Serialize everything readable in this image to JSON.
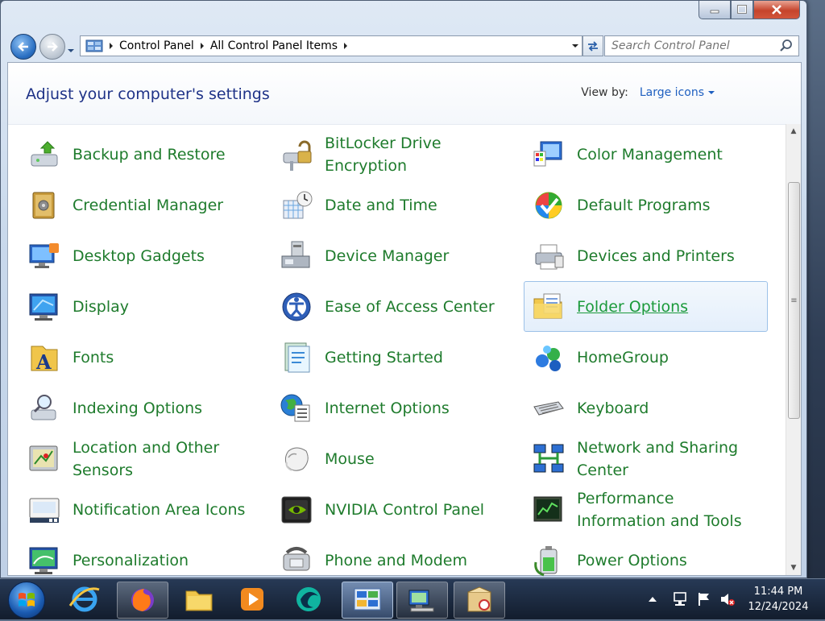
{
  "window": {
    "caption_buttons": [
      "minimize-icon",
      "maximize-icon",
      "close-icon"
    ]
  },
  "address_bar": {
    "crumbs": [
      "Control Panel",
      "All Control Panel Items"
    ]
  },
  "search": {
    "placeholder": "Search Control Panel"
  },
  "header": {
    "title": "Adjust your computer's settings",
    "view_by_label": "View by:",
    "view_by_value": "Large icons"
  },
  "items": [
    {
      "label": "Backup and Restore",
      "icon": "backup-icon"
    },
    {
      "label": "BitLocker Drive Encryption",
      "icon": "bitlocker-icon"
    },
    {
      "label": "Color Management",
      "icon": "color-management-icon"
    },
    {
      "label": "Credential Manager",
      "icon": "credential-manager-icon"
    },
    {
      "label": "Date and Time",
      "icon": "date-time-icon"
    },
    {
      "label": "Default Programs",
      "icon": "default-programs-icon"
    },
    {
      "label": "Desktop Gadgets",
      "icon": "desktop-gadgets-icon"
    },
    {
      "label": "Device Manager",
      "icon": "device-manager-icon"
    },
    {
      "label": "Devices and Printers",
      "icon": "printer-icon"
    },
    {
      "label": "Display",
      "icon": "display-icon"
    },
    {
      "label": "Ease of Access Center",
      "icon": "ease-of-access-icon"
    },
    {
      "label": "Folder Options",
      "icon": "folder-options-icon",
      "selected": true
    },
    {
      "label": "Fonts",
      "icon": "fonts-icon"
    },
    {
      "label": "Getting Started",
      "icon": "getting-started-icon"
    },
    {
      "label": "HomeGroup",
      "icon": "homegroup-icon"
    },
    {
      "label": "Indexing Options",
      "icon": "indexing-icon"
    },
    {
      "label": "Internet Options",
      "icon": "internet-options-icon"
    },
    {
      "label": "Keyboard",
      "icon": "keyboard-icon"
    },
    {
      "label": "Location and Other Sensors",
      "icon": "location-sensors-icon"
    },
    {
      "label": "Mouse",
      "icon": "mouse-icon"
    },
    {
      "label": "Network and Sharing Center",
      "icon": "network-icon"
    },
    {
      "label": "Notification Area Icons",
      "icon": "notification-area-icon"
    },
    {
      "label": "NVIDIA Control Panel",
      "icon": "nvidia-icon"
    },
    {
      "label": "Performance Information and Tools",
      "icon": "performance-icon"
    },
    {
      "label": "Personalization",
      "icon": "personalization-icon"
    },
    {
      "label": "Phone and Modem",
      "icon": "phone-modem-icon"
    },
    {
      "label": "Power Options",
      "icon": "power-options-icon"
    }
  ],
  "taskbar": {
    "apps": [
      {
        "name": "internet-explorer-icon"
      },
      {
        "name": "firefox-icon",
        "state": "open"
      },
      {
        "name": "explorer-folder-icon"
      },
      {
        "name": "media-player-icon"
      },
      {
        "name": "browser-icon"
      },
      {
        "name": "control-panel-icon",
        "state": "active"
      },
      {
        "name": "network-app-icon",
        "state": "open"
      },
      {
        "name": "package-app-icon",
        "state": "open"
      }
    ]
  },
  "tray": {
    "icons": [
      "show-hidden-icons-icon",
      "network-tray-icon",
      "action-center-flag-icon",
      "volume-muted-icon"
    ],
    "time": "11:44 PM",
    "date": "12/24/2024"
  },
  "colors": {
    "link_green": "#1e7b2c",
    "title_blue": "#1e3287",
    "accent_blue": "#1e5fc0"
  }
}
